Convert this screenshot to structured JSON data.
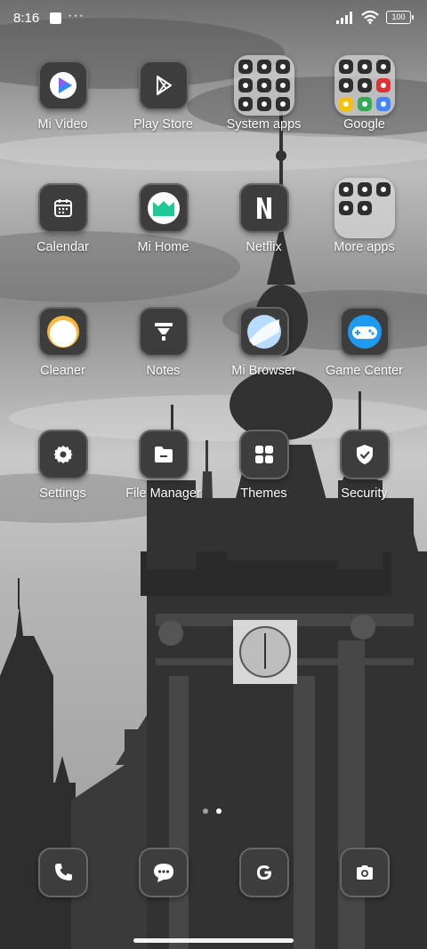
{
  "status_bar": {
    "time": "8:16",
    "overflow_indicator": "···",
    "battery_level": "100",
    "icons": [
      "notification-square-icon",
      "signal-icon",
      "wifi-icon",
      "battery-icon"
    ]
  },
  "apps": [
    {
      "label": "Mi Video",
      "icon": "mi-video-icon"
    },
    {
      "label": "Play Store",
      "icon": "play-store-icon"
    },
    {
      "label": "System apps",
      "icon": "system-apps-folder-icon"
    },
    {
      "label": "Google",
      "icon": "google-folder-icon"
    },
    {
      "label": "Calendar",
      "icon": "calendar-icon"
    },
    {
      "label": "Mi Home",
      "icon": "mi-home-icon"
    },
    {
      "label": "Netflix",
      "icon": "netflix-icon"
    },
    {
      "label": "More apps",
      "icon": "more-apps-folder-icon"
    },
    {
      "label": "Cleaner",
      "icon": "cleaner-icon"
    },
    {
      "label": "Notes",
      "icon": "notes-icon"
    },
    {
      "label": "Mi Browser",
      "icon": "mi-browser-icon"
    },
    {
      "label": "Game Center",
      "icon": "game-center-icon"
    },
    {
      "label": "Settings",
      "icon": "settings-icon"
    },
    {
      "label": "File Manager",
      "icon": "file-manager-icon"
    },
    {
      "label": "Themes",
      "icon": "themes-icon"
    },
    {
      "label": "Security",
      "icon": "security-icon"
    }
  ],
  "dock": [
    {
      "icon": "phone-icon"
    },
    {
      "icon": "messages-icon"
    },
    {
      "icon": "google-search-icon"
    },
    {
      "icon": "camera-icon"
    }
  ],
  "colors": {
    "tile": "#3d3d3d",
    "label": "#ffffff",
    "mi_home_green": "#20c997",
    "game_center_blue": "#1e9bf0",
    "cleaner_yellow": "#f6b73c"
  }
}
